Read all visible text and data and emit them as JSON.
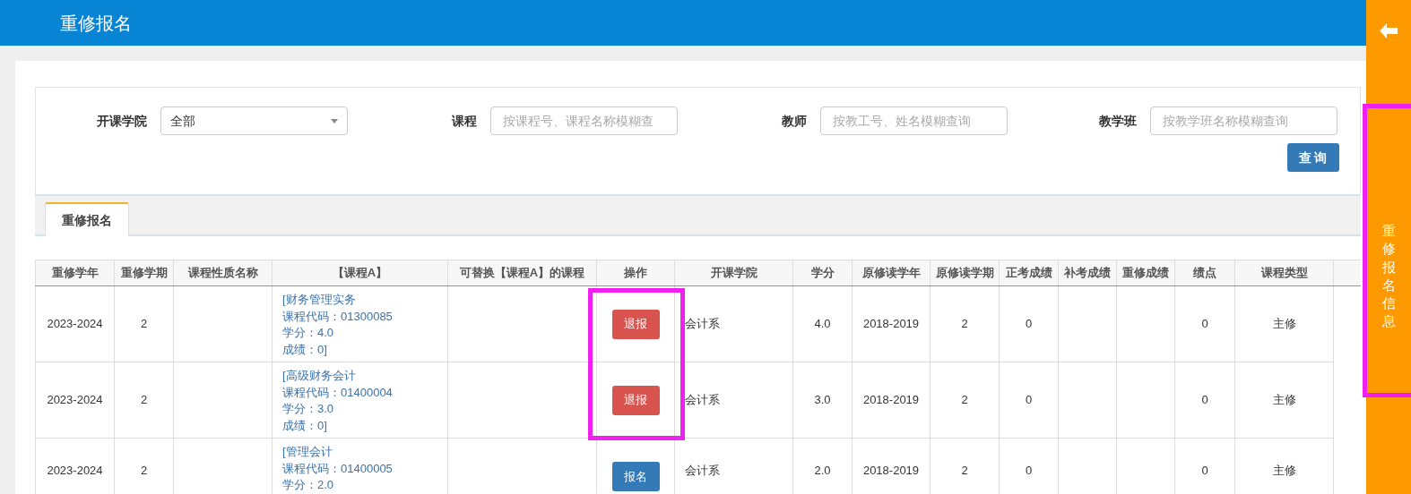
{
  "header": {
    "title": "重修报名"
  },
  "side_tab": {
    "label": "重修报名信息",
    "highlighted": true
  },
  "filters": [
    {
      "kind": "select",
      "label": "开课学院",
      "value": "全部"
    },
    {
      "kind": "input",
      "label": "课程",
      "placeholder": "按课程号、课程名称模糊查"
    },
    {
      "kind": "input",
      "label": "教师",
      "placeholder": "按教工号、姓名模糊查询"
    },
    {
      "kind": "input",
      "label": "教学班",
      "placeholder": "按教学班名称模糊查询"
    }
  ],
  "search_button": "查 询",
  "tabs": [
    {
      "label": "重修报名",
      "selected": true
    }
  ],
  "table": {
    "columns": [
      "重修学年",
      "重修学期",
      "课程性质名称",
      "【课程A】",
      "可替换【课程A】的课程",
      "操作",
      "开课学院",
      "学分",
      "原修读学年",
      "原修读学期",
      "正考成绩",
      "补考成绩",
      "重修成绩",
      "绩点",
      "课程类型"
    ],
    "rows": [
      {
        "year": "2023-2024",
        "term": "2",
        "course_a": [
          "[财务管理实务",
          "课程代码：01300085",
          "学分：4.0",
          "成绩：0]"
        ],
        "action": {
          "label": "退报",
          "kind": "withdraw",
          "highlighted": true
        },
        "college": "会计系",
        "credit": "4.0",
        "orig_year": "2018-2019",
        "orig_term": "2",
        "exam": "0",
        "gpa": "0",
        "type": "主修"
      },
      {
        "year": "2023-2024",
        "term": "2",
        "course_a": [
          "[高级财务会计",
          "课程代码：01400004",
          "学分：3.0",
          "成绩：0]"
        ],
        "action": {
          "label": "退报",
          "kind": "withdraw",
          "highlighted": true
        },
        "college": "会计系",
        "credit": "3.0",
        "orig_year": "2018-2019",
        "orig_term": "2",
        "exam": "0",
        "gpa": "0",
        "type": "主修"
      },
      {
        "year": "2023-2024",
        "term": "2",
        "course_a": [
          "[管理会计",
          "课程代码：01400005",
          "学分：2.0"
        ],
        "action": {
          "label": "报名",
          "kind": "enroll",
          "highlighted": false
        },
        "college": "会计系",
        "credit": "2.0",
        "orig_year": "2018-2019",
        "orig_term": "2",
        "exam": "0",
        "gpa": "0",
        "type": "主修"
      }
    ]
  }
}
